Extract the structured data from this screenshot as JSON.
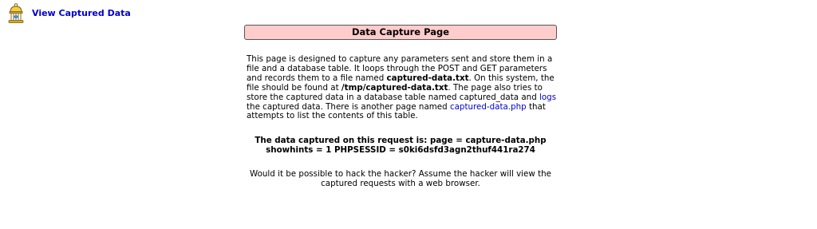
{
  "nav": {
    "view_captured_label": "View Captured Data",
    "icon": "birdcage-icon"
  },
  "main": {
    "title": "Data Capture Page",
    "description": {
      "part1": "This page is designed to capture any parameters sent and store them in a file and a database table. It loops through the POST and GET parameters and records them to a file named ",
      "file_name": "captured-data.txt",
      "part2": ". On this system, the file should be found at ",
      "file_path": "/tmp/captured-data.txt",
      "part3": ". The page also tries to store the captured data in a database table named captured_data and ",
      "logs_link": "logs",
      "part4": " the captured data. There is another page named ",
      "captured_data_link": "captured-data.php",
      "part5": " that attempts to list the contents of this table."
    },
    "captured_line1": "The data captured on this request is: page = capture-data.php",
    "captured_line2": "showhints = 1 PHPSESSID = s0ki6dsfd3agn2thuf441ra274",
    "hack_question": "Would it be possible to hack the hacker? Assume the hacker will view the captured requests with a web browser."
  }
}
